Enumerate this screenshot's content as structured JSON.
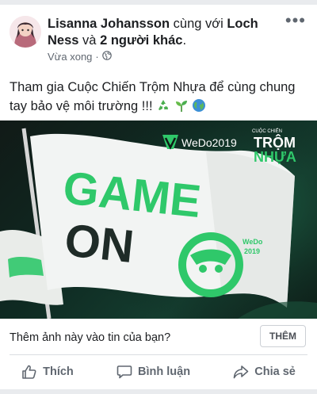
{
  "post": {
    "author": "Lisanna Johansson",
    "with_text": "cùng với",
    "tagged": "Loch Ness",
    "and_text": "và",
    "others": "2 người khác",
    "period": ".",
    "time": "Vừa xong",
    "dot": "·",
    "body": "Tham gia Cuộc Chiến Trộm Nhựa để cùng chung tay bảo vệ môi trường !!!",
    "emojis": [
      "recycle-icon",
      "seedling-icon",
      "globe-icon"
    ]
  },
  "photo": {
    "brand": "WeDo2019",
    "campaign_small": "CUỘC CHIẾN",
    "campaign_top": "TRỘM",
    "campaign_bottom": "NHỰA",
    "flag_line1": "GAME",
    "flag_line2": "ON",
    "badge_text1": "WeDo",
    "badge_text2": "2019"
  },
  "composer": {
    "question": "Thêm ảnh này vào tin của bạn?",
    "add_label": "THÊM"
  },
  "actions": {
    "like": "Thích",
    "comment": "Bình luận",
    "share": "Chia sẻ"
  },
  "colors": {
    "brand_green": "#2fc86a",
    "text": "#1c1e21",
    "muted": "#606770"
  }
}
